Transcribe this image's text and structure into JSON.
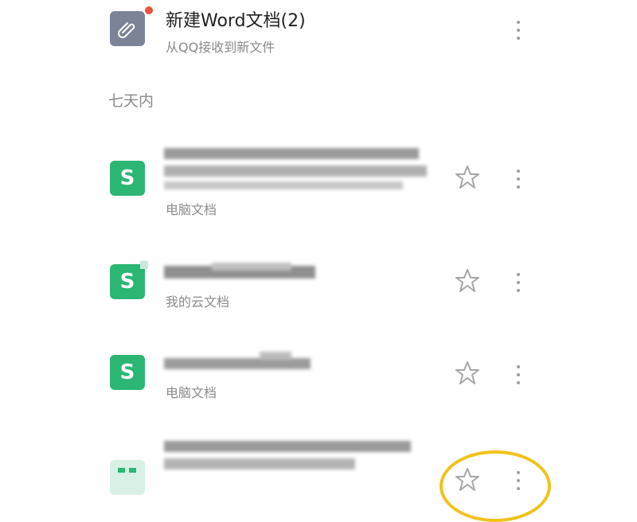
{
  "top_file": {
    "title": "新建Word文档(2)",
    "subtitle": "从QQ接收到新文件",
    "icon": "paperclip-icon",
    "badge_color": "#e8533b"
  },
  "section": {
    "label": "七天内"
  },
  "files": [
    {
      "icon": "wps-sheet-icon",
      "title": "",
      "subtitle": "电脑文档"
    },
    {
      "icon": "wps-sheet-icon",
      "title": "",
      "subtitle": "我的云文档"
    },
    {
      "icon": "wps-sheet-icon",
      "title": "",
      "subtitle": "电脑文档"
    },
    {
      "icon": "wps-doc-icon",
      "title": "",
      "subtitle": ""
    }
  ],
  "colors": {
    "wps_green": "#2bb674",
    "gray_icon": "#7a8496",
    "annotation_circle": "#f1c21b"
  }
}
